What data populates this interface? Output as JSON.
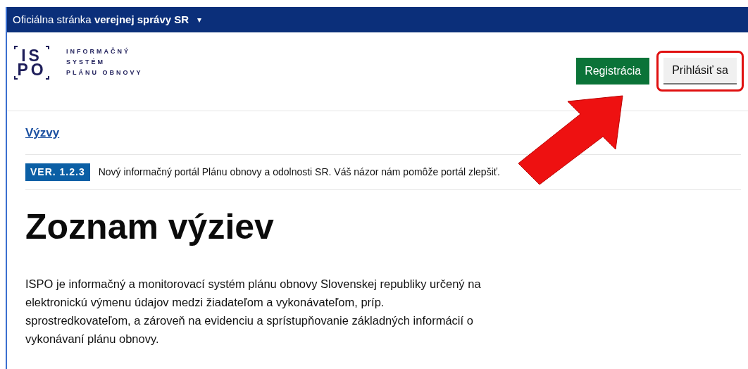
{
  "gov_banner": {
    "text": "Oficiálna stránka **verejnej správy SR**",
    "caret": "▾"
  },
  "logo": {
    "letters_top": "IS",
    "letters_bottom": "PO",
    "lines": [
      "INFORMAČNÝ",
      "SYSTÉM",
      "PLÁNU OBNOVY"
    ]
  },
  "header_buttons": [
    {
      "kind": "primary",
      "label": "Registrácia",
      "highlighted": false
    },
    {
      "kind": "secondary",
      "label": "Prihlásiť sa",
      "highlighted": true
    }
  ],
  "breadcrumb": {
    "link": "Výzvy"
  },
  "version_notice": {
    "badge": "VER. 1.2.3",
    "text": "Nový informačný portál Plánu obnovy a odolnosti SR. Váš názor nám pomôže portál zlepšiť."
  },
  "heading": "Zoznam výziev",
  "description": "ISPO je informačný a monitorovací systém plánu obnovy Slovenskej republiky určený na elektronickú výmenu údajov medzi žiadateľom a vykonávateľom, príp. sprostredkovateľom, a zároveň na evidenciu a sprístupňovanie základných informácií o vykonávaní plánu obnovy."
}
